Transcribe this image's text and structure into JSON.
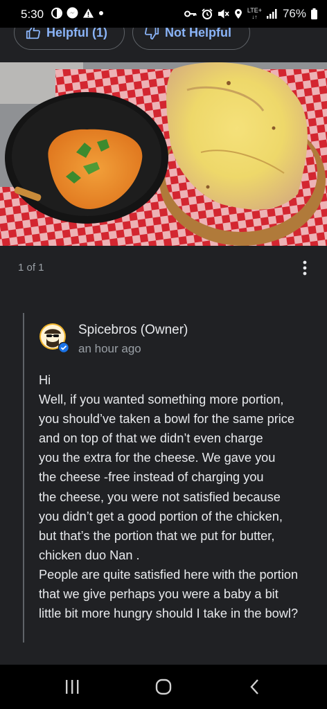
{
  "status_bar": {
    "time": "5:30",
    "network_label": "LTE+",
    "battery_percent": "76%"
  },
  "review_actions": {
    "helpful_label": "Helpful (1)",
    "not_helpful_label": "Not Helpful"
  },
  "photo": {
    "counter": "1 of 1"
  },
  "owner_reply": {
    "name": "Spicebros (Owner)",
    "time": "an hour ago",
    "text": "Hi\nWell, if you wanted something more portion,\nyou should’ve taken a bowl for the same price\nand on top of that we didn’t even charge\nyou the extra for the cheese. We gave you\nthe cheese -free instead of charging you\nthe cheese, you were not satisfied because\nyou didn’t get a good portion of the chicken,\nbut that’s the portion that we put for butter,\nchicken duo Nan .\nPeople are quite satisfied here with the portion\nthat we give perhaps you were a baby a bit\nlittle bit more hungry should I take in the bowl?"
  },
  "icons": {
    "thumbs_up": "thumbs-up-icon",
    "thumbs_down": "thumbs-down-icon",
    "more": "more-vert-icon",
    "verified": "verified-badge-icon"
  },
  "colors": {
    "background": "#202124",
    "accent": "#8ab4f8",
    "muted_text": "#9aa0a6",
    "verified": "#1a73e8"
  }
}
